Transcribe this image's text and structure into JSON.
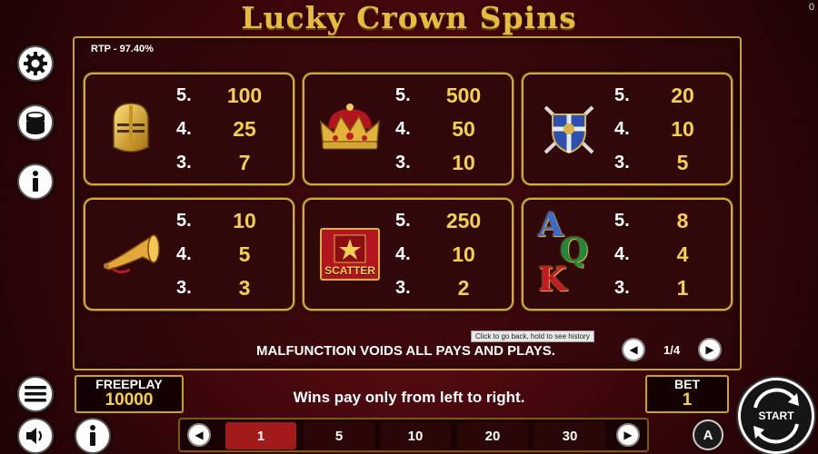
{
  "title": "Lucky Crown Spins",
  "corner_counter": "0",
  "rtp": "RTP - 97.40%",
  "paytable": [
    {
      "symbol": "knight-helmet",
      "pays": [
        {
          "count": "5.",
          "value": "100"
        },
        {
          "count": "4.",
          "value": "25"
        },
        {
          "count": "3.",
          "value": "7"
        }
      ]
    },
    {
      "symbol": "crown",
      "pays": [
        {
          "count": "5.",
          "value": "500"
        },
        {
          "count": "4.",
          "value": "50"
        },
        {
          "count": "3.",
          "value": "10"
        }
      ]
    },
    {
      "symbol": "shield-swords",
      "pays": [
        {
          "count": "5.",
          "value": "20"
        },
        {
          "count": "4.",
          "value": "10"
        },
        {
          "count": "3.",
          "value": "5"
        }
      ]
    },
    {
      "symbol": "horn",
      "pays": [
        {
          "count": "5.",
          "value": "10"
        },
        {
          "count": "4.",
          "value": "5"
        },
        {
          "count": "3.",
          "value": "3"
        }
      ]
    },
    {
      "symbol": "scatter",
      "label": "SCATTER",
      "pays": [
        {
          "count": "5.",
          "value": "250"
        },
        {
          "count": "4.",
          "value": "10"
        },
        {
          "count": "3.",
          "value": "2"
        }
      ]
    },
    {
      "symbol": "aqk",
      "letters": [
        "A",
        "Q",
        "K"
      ],
      "pays": [
        {
          "count": "5.",
          "value": "8"
        },
        {
          "count": "4.",
          "value": "4"
        },
        {
          "count": "3.",
          "value": "1"
        }
      ]
    }
  ],
  "malfunction": "MALFUNCTION VOIDS ALL PAYS AND PLAYS.",
  "tooltip": "Click to go back, hold to see history",
  "page_indicator": "1/4",
  "freeplay": {
    "label": "FREEPLAY",
    "value": "10000"
  },
  "bet": {
    "label": "BET",
    "value": "1"
  },
  "wins_message": "Wins pay only from left to right.",
  "bet_options": [
    "1",
    "5",
    "10",
    "20",
    "30"
  ],
  "selected_bet": "1",
  "start_label": "START",
  "auto_label": "A",
  "colors": {
    "gold": "#f5d04a",
    "panel_border": "#d4ab36",
    "active_bet": "#a21a1a",
    "background": "#3a060a"
  }
}
